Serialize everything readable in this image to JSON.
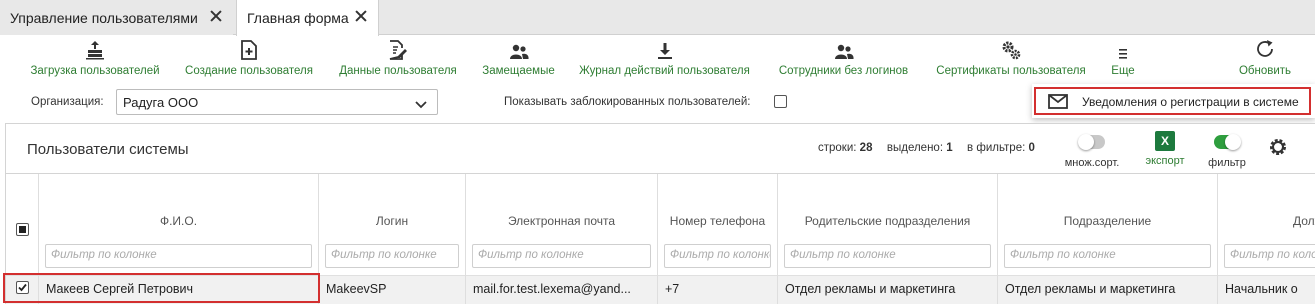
{
  "tabs": [
    {
      "label": "Управление пользователями",
      "active": false
    },
    {
      "label": "Главная форма",
      "active": true
    }
  ],
  "toolbar": {
    "items": [
      {
        "label": "Загрузка пользователей",
        "icon": "upload-users-icon"
      },
      {
        "label": "Создание пользователя",
        "icon": "add-file-icon"
      },
      {
        "label": "Данные пользователя",
        "icon": "edit-file-icon"
      },
      {
        "label": "Замещаемые",
        "icon": "users-icon"
      },
      {
        "label": "Журнал действий пользователя",
        "icon": "download-icon"
      },
      {
        "label": "Сотрудники без логинов",
        "icon": "users-icon"
      },
      {
        "label": "Сертификаты пользователя",
        "icon": "gears-icon"
      },
      {
        "label": "Еще",
        "icon": "menu-icon"
      },
      {
        "label": "Обновить",
        "icon": "refresh-icon"
      }
    ]
  },
  "filters": {
    "org_label": "Организация:",
    "org_value": "Радуга ООО",
    "show_blocked_label": "Показывать заблокированных пользователей:",
    "show_blocked_checked": false
  },
  "dropdown": {
    "item_label": "Уведомления о регистрации в системе",
    "item_icon": "mail-icon"
  },
  "panel": {
    "title": "Пользователи системы",
    "stats": {
      "rows_label": "строки:",
      "rows_value": "28",
      "selected_label": "выделено:",
      "selected_value": "1",
      "in_filter_label": "в фильтре:",
      "in_filter_value": "0"
    },
    "multisort_label": "множ.сорт.",
    "multisort_on": false,
    "export_label": "экспорт",
    "export_icon_text": "X",
    "filter_label": "фильтр",
    "filter_on": true
  },
  "grid": {
    "filter_placeholder": "Фильтр по колонке",
    "columns": [
      "Ф.И.О.",
      "Логин",
      "Электронная почта",
      "Номер телефона",
      "Родительские подразделения",
      "Подразделение",
      "Должность"
    ],
    "rows": [
      {
        "checked": true,
        "cells": [
          "Макеев Сергей Петрович",
          "MakeevSP",
          "mail.for.test.lexema@yand...",
          "+7",
          "Отдел рекламы и маркетинга",
          "Отдел рекламы и маркетинга",
          "Начальник о"
        ]
      }
    ]
  },
  "colors": {
    "accent_green": "#2e7d32",
    "highlight_red": "#d32f2f",
    "excel_green": "#1d7a3e"
  }
}
